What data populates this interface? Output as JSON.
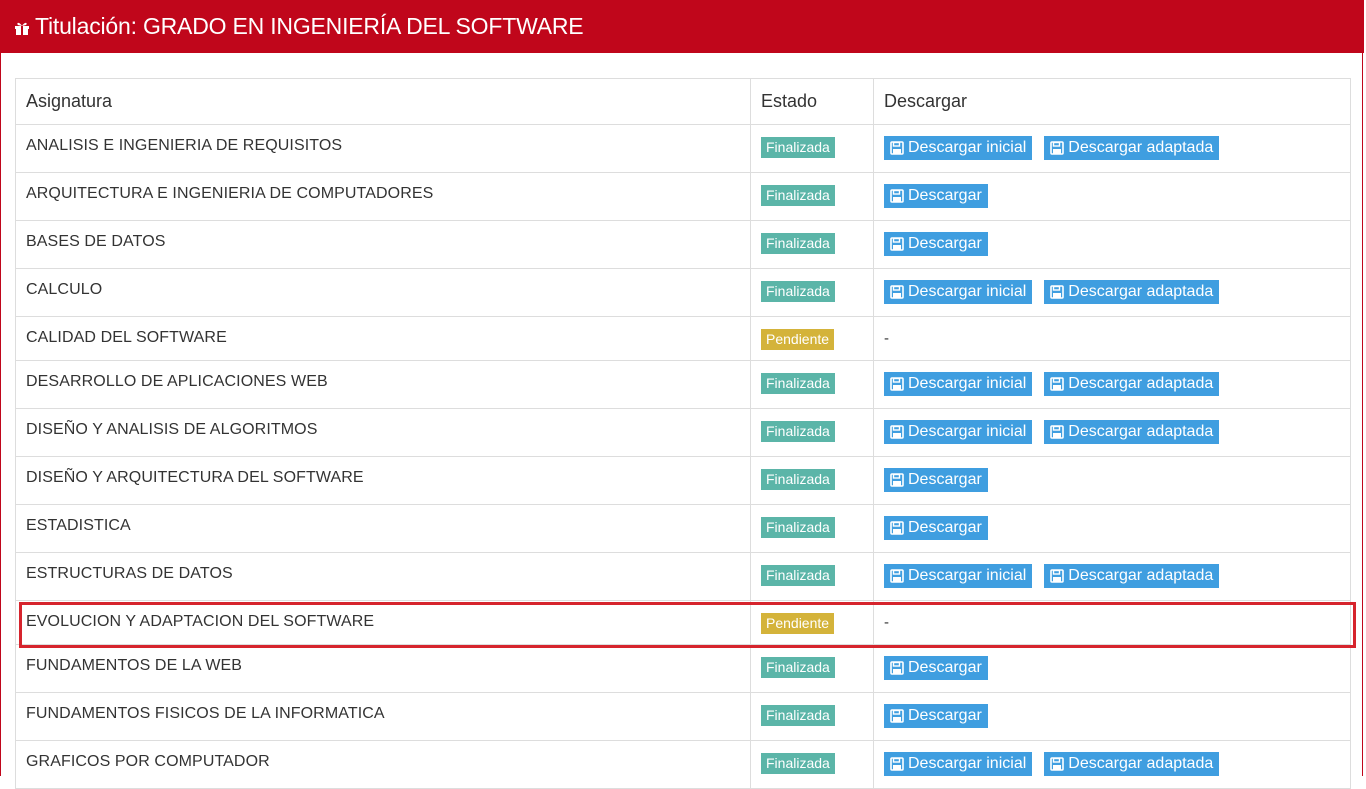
{
  "header": {
    "title": "Titulación: GRADO EN INGENIERÍA DEL SOFTWARE",
    "icon": "gift-icon"
  },
  "columns": [
    "Asignatura",
    "Estado",
    "Descargar"
  ],
  "rows": [
    {
      "name": "ANALISIS E INGENIERIA DE REQUISITOS",
      "status": "Finalizada",
      "downloads": [
        "Descargar inicial",
        "Descargar adaptada"
      ]
    },
    {
      "name": "ARQUITECTURA E INGENIERIA DE COMPUTADORES",
      "status": "Finalizada",
      "downloads": [
        "Descargar"
      ]
    },
    {
      "name": "BASES DE DATOS",
      "status": "Finalizada",
      "downloads": [
        "Descargar"
      ]
    },
    {
      "name": "CALCULO",
      "status": "Finalizada",
      "downloads": [
        "Descargar inicial",
        "Descargar adaptada"
      ]
    },
    {
      "name": "CALIDAD DEL SOFTWARE",
      "status": "Pendiente",
      "downloads": [],
      "empty": "-"
    },
    {
      "name": "DESARROLLO DE APLICACIONES WEB",
      "status": "Finalizada",
      "downloads": [
        "Descargar inicial",
        "Descargar adaptada"
      ]
    },
    {
      "name": "DISEÑO Y ANALISIS DE ALGORITMOS",
      "status": "Finalizada",
      "downloads": [
        "Descargar inicial",
        "Descargar adaptada"
      ]
    },
    {
      "name": "DISEÑO Y ARQUITECTURA DEL SOFTWARE",
      "status": "Finalizada",
      "downloads": [
        "Descargar"
      ]
    },
    {
      "name": "ESTADISTICA",
      "status": "Finalizada",
      "downloads": [
        "Descargar"
      ]
    },
    {
      "name": "ESTRUCTURAS DE DATOS",
      "status": "Finalizada",
      "downloads": [
        "Descargar inicial",
        "Descargar adaptada"
      ]
    },
    {
      "name": "EVOLUCION Y ADAPTACION DEL SOFTWARE",
      "status": "Pendiente",
      "downloads": [],
      "empty": "-"
    },
    {
      "name": "FUNDAMENTOS DE LA WEB",
      "status": "Finalizada",
      "downloads": [
        "Descargar"
      ]
    },
    {
      "name": "FUNDAMENTOS FISICOS DE LA INFORMATICA",
      "status": "Finalizada",
      "downloads": [
        "Descargar"
      ]
    },
    {
      "name": "GRAFICOS POR COMPUTADOR",
      "status": "Finalizada",
      "downloads": [
        "Descargar inicial",
        "Descargar adaptada"
      ]
    }
  ],
  "colors": {
    "header_bg": "#c0061b",
    "finalizada": "#5bb5a8",
    "pendiente": "#d4b33a",
    "button": "#3f9ee0",
    "highlight": "#d6242d"
  }
}
